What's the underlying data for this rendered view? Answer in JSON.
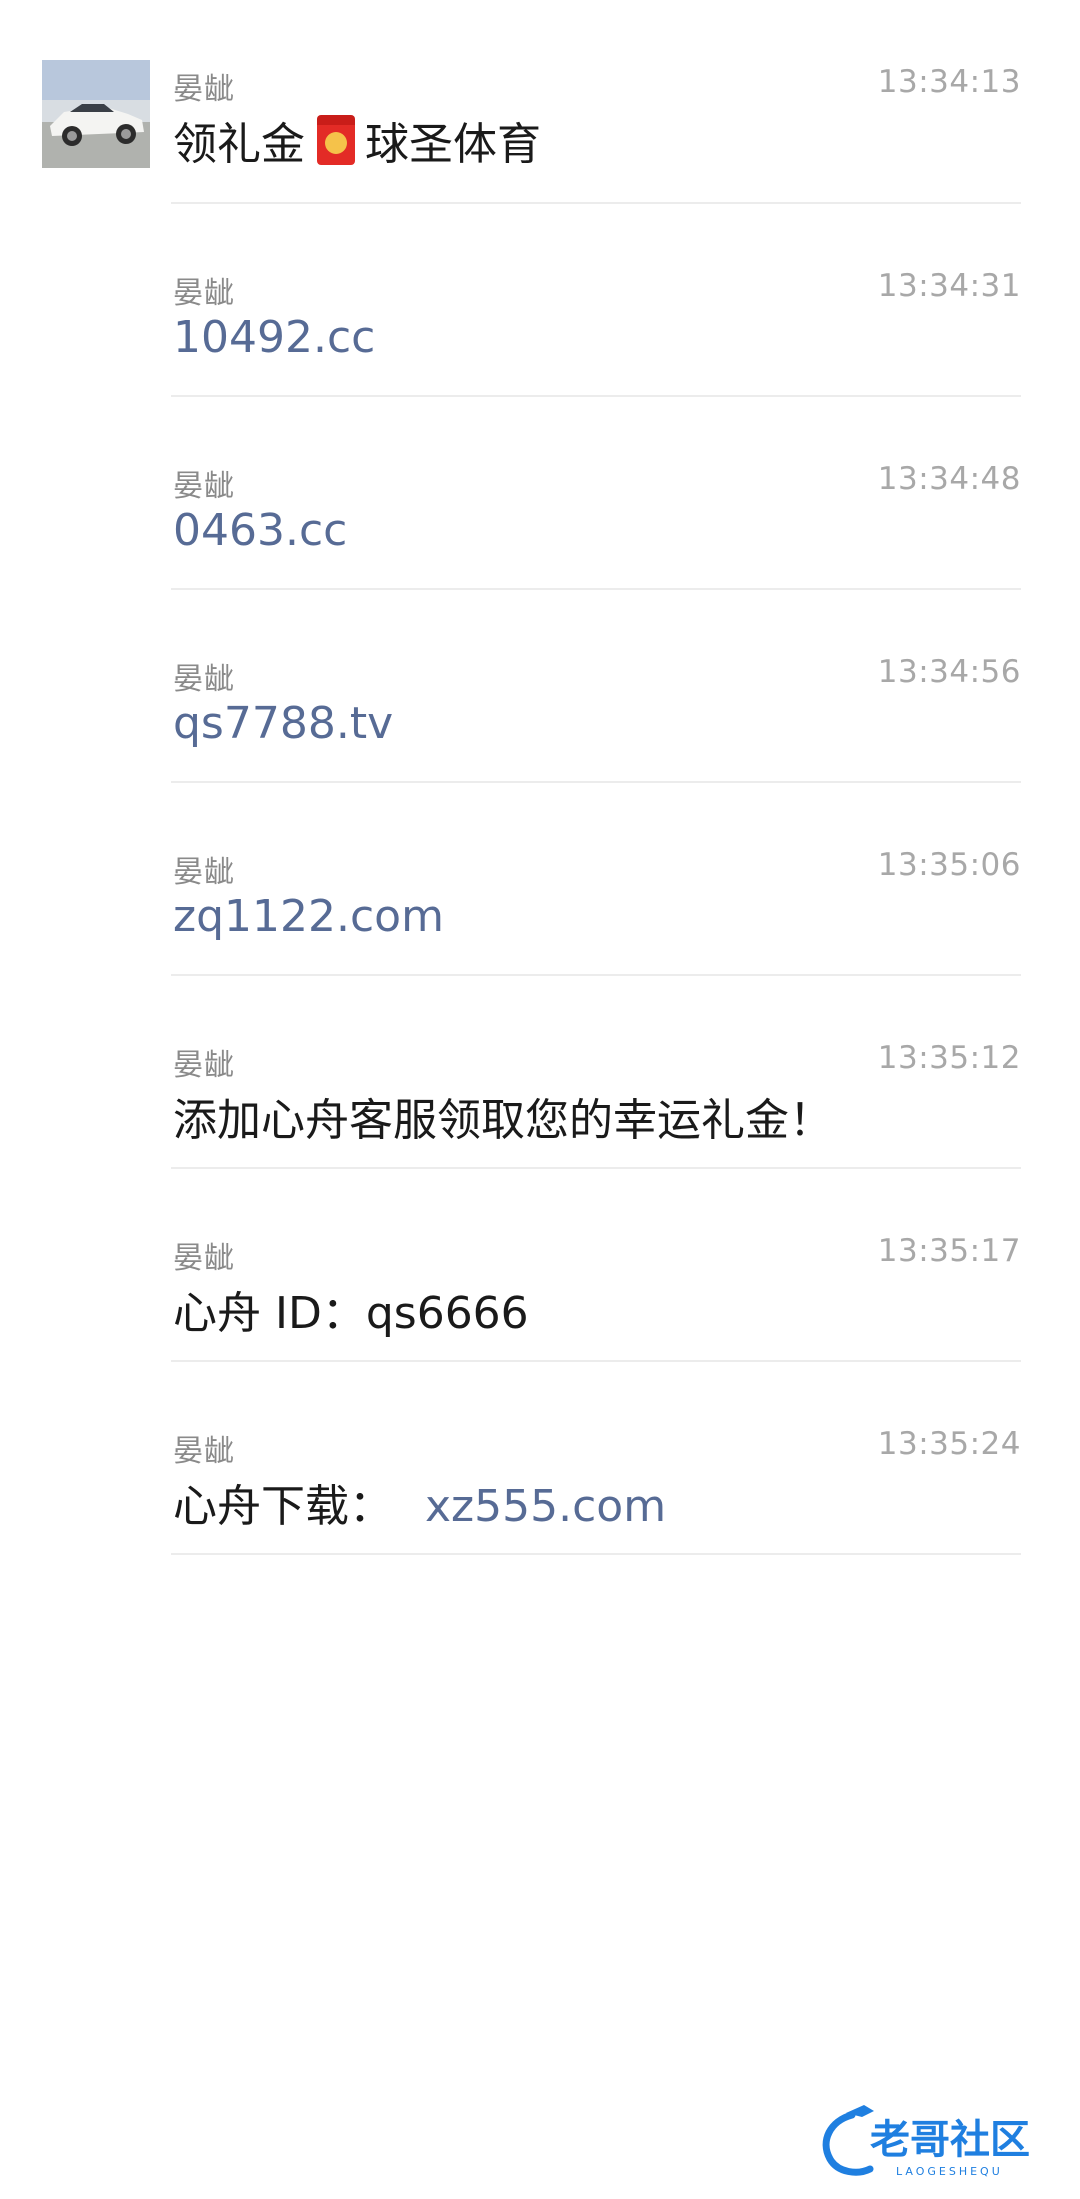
{
  "messages": [
    {
      "sender": "晏龇",
      "time": "13:34:13",
      "text": "领礼金",
      "text_after": "球圣体育",
      "has_envelope": true
    },
    {
      "sender": "晏龇",
      "time": "13:34:31",
      "link": "10492.cc"
    },
    {
      "sender": "晏龇",
      "time": "13:34:48",
      "link": "0463.cc"
    },
    {
      "sender": "晏龇",
      "time": "13:34:56",
      "link": "qs7788.tv"
    },
    {
      "sender": "晏龇",
      "time": "13:35:06",
      "link": "zq1122.com"
    },
    {
      "sender": "晏龇",
      "time": "13:35:12",
      "text": "添加心舟客服领取您的幸运礼金！"
    },
    {
      "sender": "晏龇",
      "time": "13:35:17",
      "text": "心舟 ID：qs6666"
    },
    {
      "sender": "晏龇",
      "time": "13:35:24",
      "text": "心舟下载：",
      "link": "xz555.com"
    }
  ],
  "watermark": {
    "title": "老哥社区",
    "subtitle": "LAOGESHEQU"
  },
  "colors": {
    "link": "#576b95",
    "text": "#1a1a1a",
    "meta": "#8a8a8a",
    "divider": "#ececec",
    "watermark": "#1f7fe0"
  },
  "icons": {
    "avatar": "white-car-photo",
    "envelope": "red-envelope-icon"
  }
}
